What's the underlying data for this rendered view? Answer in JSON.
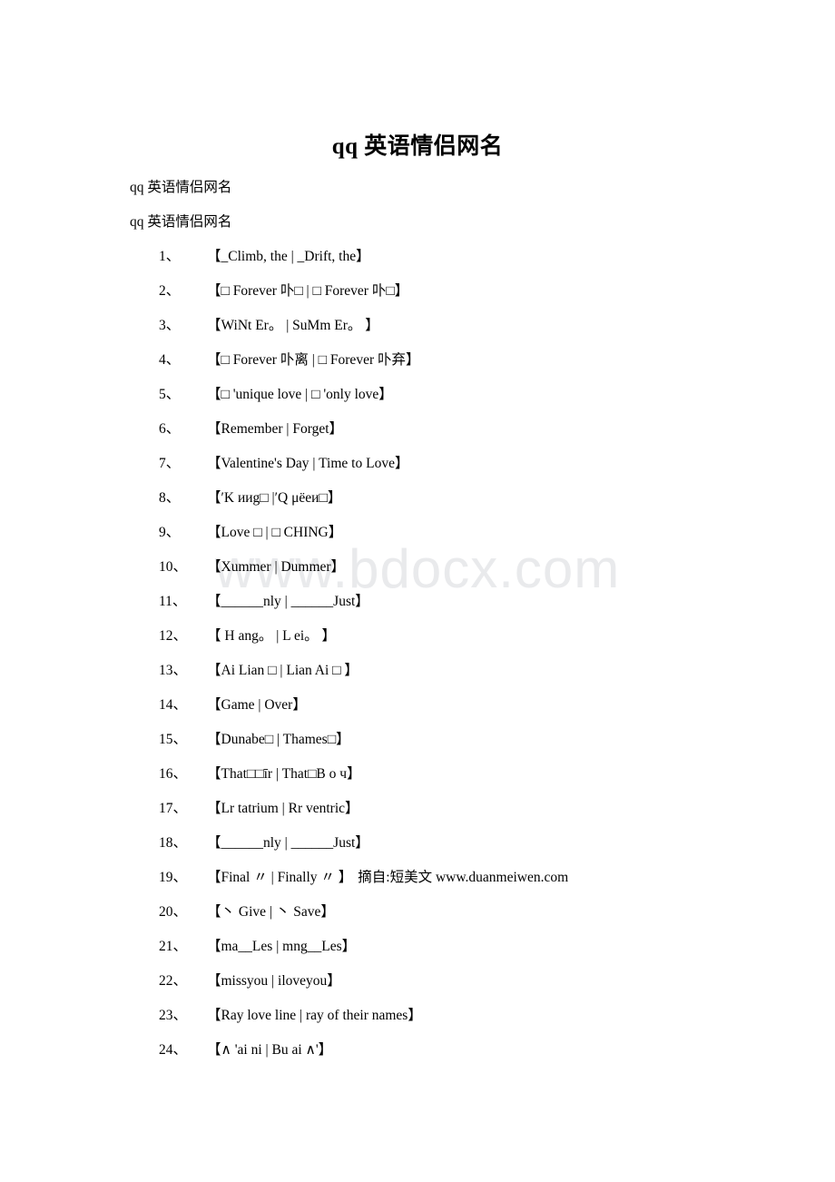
{
  "document": {
    "title": "qq 英语情侣网名",
    "intro_lines": [
      "qq 英语情侣网名",
      "qq 英语情侣网名"
    ],
    "watermark": "www.bdocx.com",
    "source_note": "摘自:短美文 www.duanmeiwen.com",
    "colors": {
      "text": "#000000",
      "watermark": "#e9eaec",
      "background": "#ffffff"
    }
  },
  "list": {
    "num_suffix": "、",
    "items": [
      {
        "num": "1、",
        "text": "【_Climb, the | _Drift, the】",
        "note": ""
      },
      {
        "num": "2、",
        "text": "【□ Forever 卟□ | □ Forever 卟□】",
        "note": ""
      },
      {
        "num": "3、",
        "text": "【WiNt Er。 | SuMm Er。 】",
        "note": ""
      },
      {
        "num": "4、",
        "text": "【□ Forever 卟离 | □ Forever 卟弃】",
        "note": ""
      },
      {
        "num": "5、",
        "text": "【□ 'unique love | □ 'only love】",
        "note": ""
      },
      {
        "num": "6、",
        "text": "【Remember | Forget】",
        "note": ""
      },
      {
        "num": "7、",
        "text": "【Valentine's Day | Time to Love】",
        "note": ""
      },
      {
        "num": "8、",
        "text": "【′K иᴎg□ |′Q μёеи□】",
        "note": ""
      },
      {
        "num": "9、",
        "text": "【Love □ | □ CHING】",
        "note": ""
      },
      {
        "num": "10、",
        "text": "【Xummer | Dummer】",
        "note": ""
      },
      {
        "num": "11、",
        "text": "【______nly | ______Just】",
        "note": ""
      },
      {
        "num": "12、",
        "text": "【 H ang。 | L ei。 】",
        "note": ""
      },
      {
        "num": "13、",
        "text": "【Ai Lian □ | Lian Ai □ 】",
        "note": ""
      },
      {
        "num": "14、",
        "text": "【Game | Over】",
        "note": ""
      },
      {
        "num": "15、",
        "text": "【Dunabe□ | Thames□】",
        "note": ""
      },
      {
        "num": "16、",
        "text": "【That□□īr | That□B о ч】",
        "note": ""
      },
      {
        "num": "17、",
        "text": "【Lr tatrium | Rr ventric】",
        "note": ""
      },
      {
        "num": "18、",
        "text": "【______nly | ______Just】",
        "note": ""
      },
      {
        "num": "19、",
        "text": "【Final 〃 | Finally 〃 】",
        "note": "摘自:短美文 www.duanmeiwen.com"
      },
      {
        "num": "20、",
        "text": "【丶 Give | 丶 Save】",
        "note": ""
      },
      {
        "num": "21、",
        "text": "【ma__Les | mng__Les】",
        "note": ""
      },
      {
        "num": "22、",
        "text": "【missyou | iloveyou】",
        "note": ""
      },
      {
        "num": "23、",
        "text": "【Ray love line | ray of their names】",
        "note": ""
      },
      {
        "num": "24、",
        "text": "【∧ 'ai ni | Bu ai ∧'】",
        "note": ""
      }
    ]
  }
}
